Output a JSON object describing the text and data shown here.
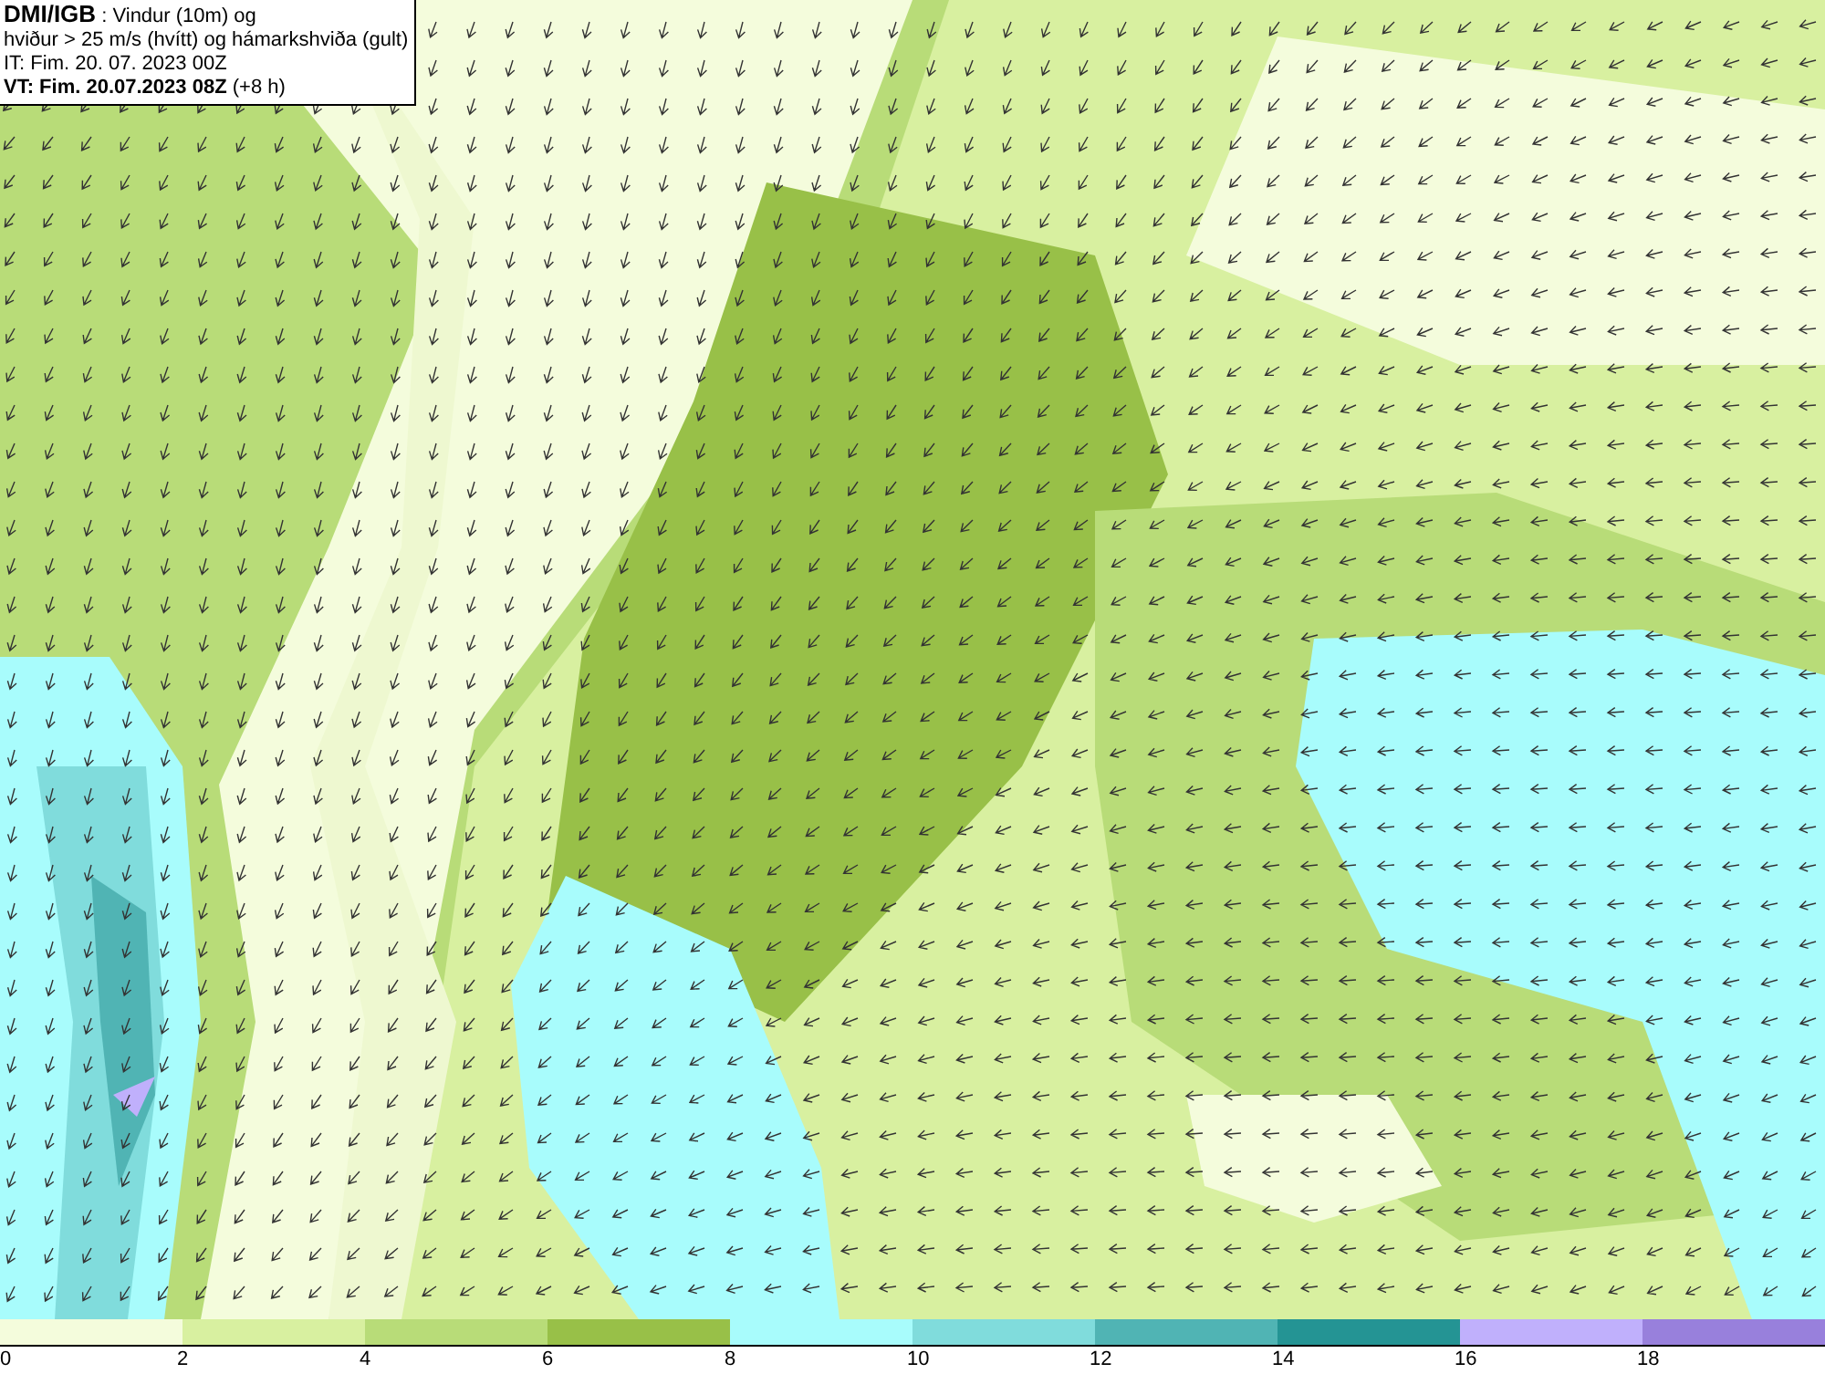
{
  "info_box": {
    "lines": [
      "**DMI/IGB** : Vindur (10m) og",
      "hviður > 25 m/s (hvítt) og hámarkshviða (gult)",
      "IT: Fim. 20. 07. 2023 00Z",
      "**VT: Fim. 20.07.2023 08Z** (+8 h)"
    ]
  },
  "legend": {
    "bins": [
      {
        "label": "0",
        "color": "#f4fcdc"
      },
      {
        "label": "2",
        "color": "#d8f0a0"
      },
      {
        "label": "4",
        "color": "#b8dc78"
      },
      {
        "label": "6",
        "color": "#98c048"
      },
      {
        "label": "8",
        "color": "#a8fcfc"
      },
      {
        "label": "10",
        "color": "#80dcdc"
      },
      {
        "label": "12",
        "color": "#50b4b4"
      },
      {
        "label": "14",
        "color": "#249494"
      },
      {
        "label": "16",
        "color": "#c0b0fc"
      },
      {
        "label": "18",
        "color": "#9880dc"
      }
    ]
  }
}
